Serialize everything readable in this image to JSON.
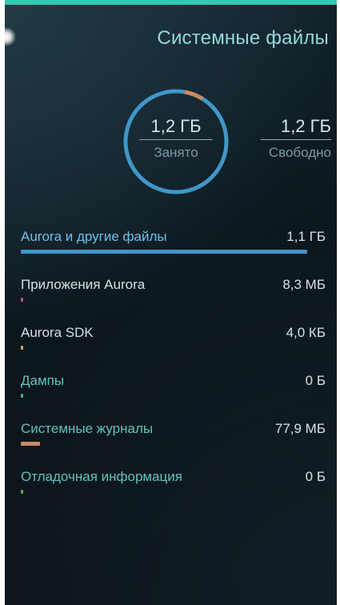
{
  "header": {
    "title": "Системные файлы"
  },
  "summary": {
    "used_value": "1,2 ГБ",
    "used_label": "Занято",
    "free_value": "1,2 ГБ",
    "free_label": "Свободно",
    "ring_color": "#3f97c9",
    "ring_segment_color": "#c98a60",
    "ring_segment_fraction": 0.06
  },
  "items": [
    {
      "name": "Aurora и другие файлы",
      "size": "1,1 ГБ",
      "name_color": "#6dc0ea",
      "bar_color": "#3f97c9",
      "fill": 1.0
    },
    {
      "name": "Приложения Aurora",
      "size": "8,3 МБ",
      "name_color": "#d3e0e4",
      "bar_color": "#c0508f",
      "fill": 0.007
    },
    {
      "name": "Aurora SDK",
      "size": "4,0 КБ",
      "name_color": "#d3e0e4",
      "bar_color": "#d1a94c",
      "fill": 0.0
    },
    {
      "name": "Дампы",
      "size": "0 Б",
      "name_color": "#5fc4bd",
      "bar_color": "#4aa9a9",
      "fill": 0.0
    },
    {
      "name": "Системные журналы",
      "size": "77,9 МБ",
      "name_color": "#5fc4bd",
      "bar_color": "#c98a60",
      "fill": 0.068
    },
    {
      "name": "Отладочная информация",
      "size": "0 Б",
      "name_color": "#5fc4bd",
      "bar_color": "#6aa150",
      "fill": 0.0
    }
  ]
}
